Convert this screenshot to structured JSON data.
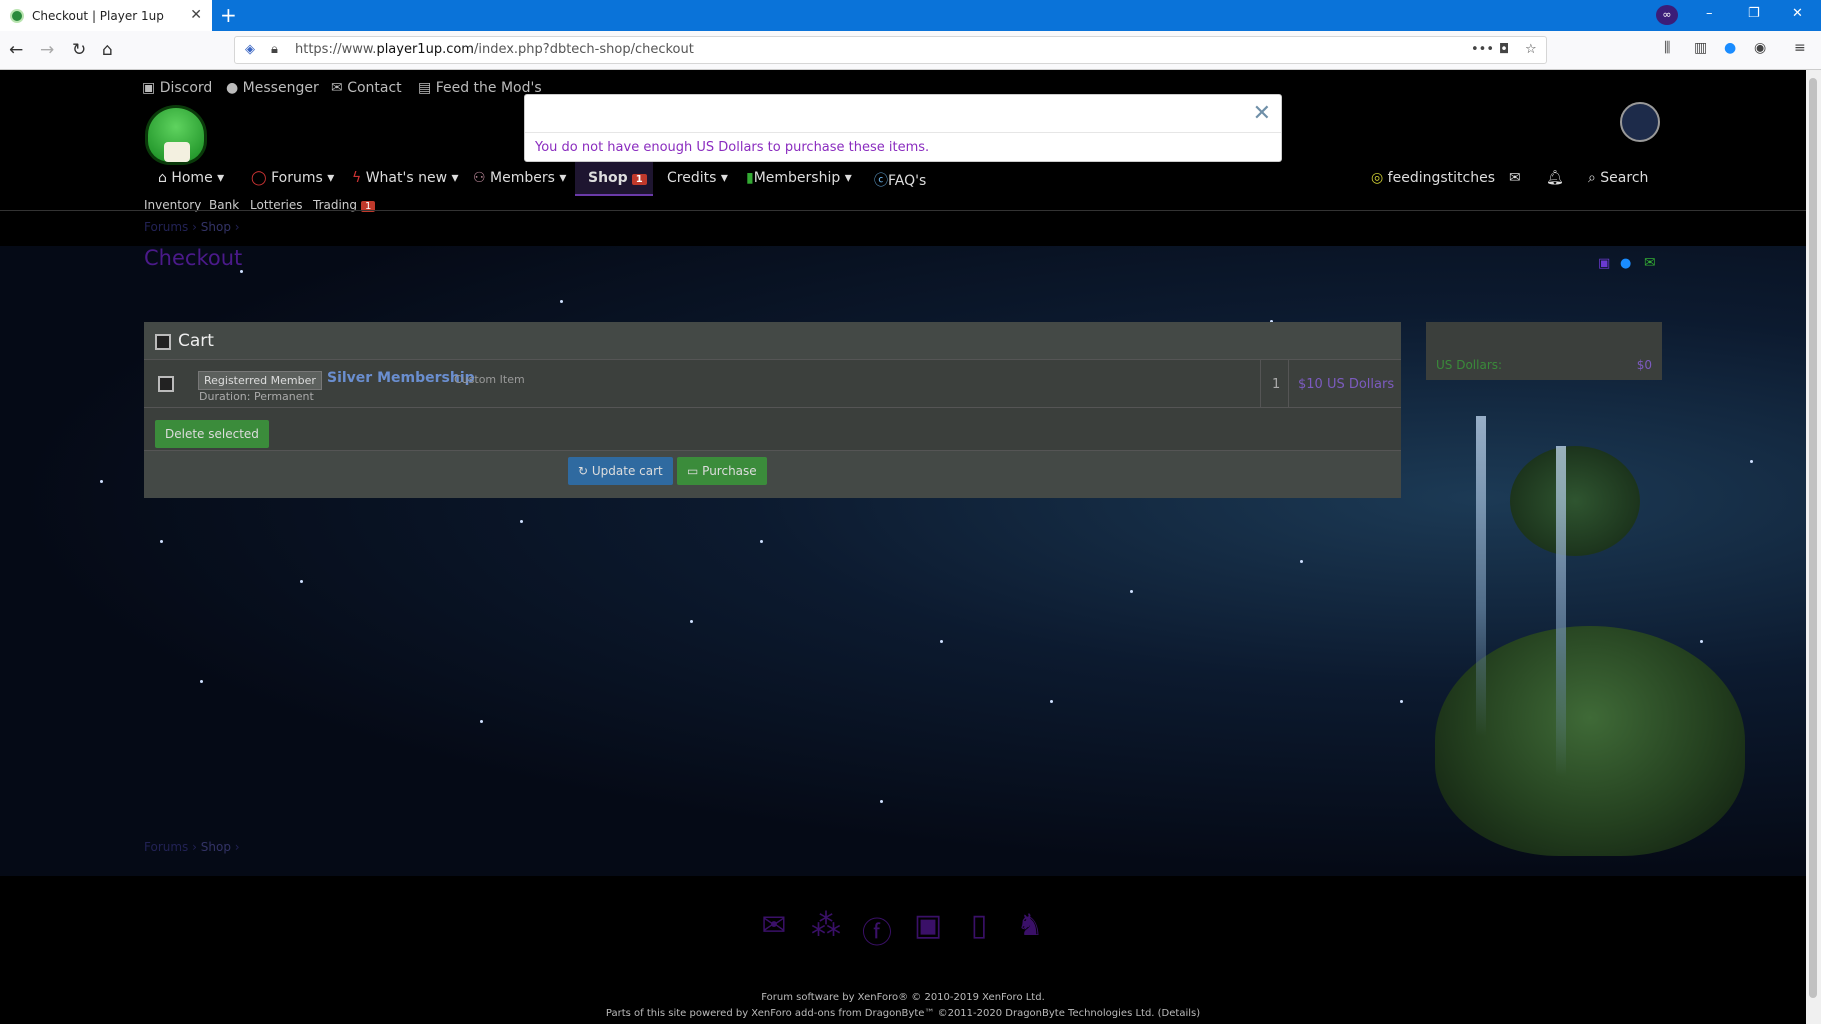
{
  "browser": {
    "tab_title": "Checkout | Player 1up",
    "new_tab": "+",
    "url_prefix": "https://www.",
    "url_host": "player1up.com",
    "url_path": "/index.php?dbtech-shop/checkout",
    "min": "–",
    "restore": "❐",
    "close": "✕"
  },
  "toplinks": [
    "Discord",
    "Messenger",
    "Contact",
    "Feed the Mod's"
  ],
  "nav": {
    "home": "Home",
    "forums": "Forums",
    "whats_new": "What's new",
    "members": "Members",
    "shop": "Shop",
    "shop_badge": "1",
    "credits": "Credits",
    "membership": "Membership",
    "faqs": "FAQ's",
    "user": "feedingstitches",
    "search": "Search"
  },
  "subnav": {
    "inventory": "Inventory",
    "bank": "Bank",
    "lotteries": "Lotteries",
    "trading": "Trading",
    "trading_badge": "1"
  },
  "popup": {
    "close": "✕",
    "message": "You do not have enough US Dollars to purchase these items."
  },
  "breadcrumb": {
    "forums": "Forums",
    "shop": "Shop",
    "sep": "›"
  },
  "page_title": "Checkout",
  "cart": {
    "heading": "Cart",
    "item": {
      "tag": "Registerred Member",
      "name": "Silver Membership",
      "type": "Custom Item",
      "duration": "Duration: Permanent",
      "qty": "1",
      "price": "$10 US Dollars"
    },
    "delete_label": "Delete selected",
    "update_label": "Update cart",
    "purchase_label": "Purchase"
  },
  "sidebar": {
    "label": "US Dollars:",
    "value": "$0"
  },
  "footer": {
    "line1": "Forum software by XenForo® © 2010-2019 XenForo Ltd.",
    "line2": "Parts of this site powered by XenForo add-ons from DragonByte™ ©2011-2020 DragonByte Technologies Ltd. (Details)"
  }
}
